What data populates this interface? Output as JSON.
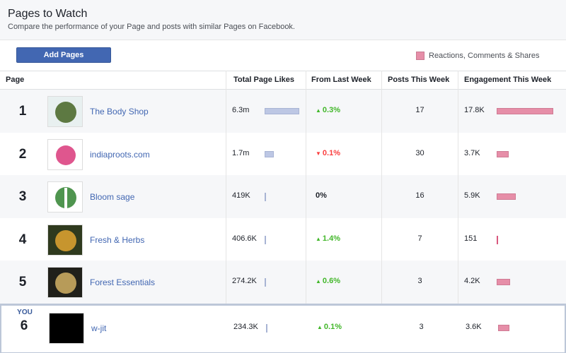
{
  "header": {
    "title": "Pages to Watch",
    "subtitle": "Compare the performance of your Page and posts with similar Pages on Facebook."
  },
  "toolbar": {
    "add_pages_label": "Add Pages"
  },
  "legend": {
    "label": "Reactions, Comments & Shares",
    "color": "#e68ea8"
  },
  "colors": {
    "accent": "#4267b2",
    "positive": "#42b72a",
    "negative": "#fa3e3e",
    "likes_bar": "#bdc7e4",
    "engagement_bar": "#e68ea8"
  },
  "table": {
    "columns": [
      "Page",
      "Total Page Likes",
      "From Last Week",
      "Posts This Week",
      "Engagement This Week"
    ],
    "you_label": "YOU",
    "rows": [
      {
        "rank": "1",
        "name": "The Body Shop",
        "likes": "6.3m",
        "likes_value": 6300000,
        "change": "0.3%",
        "direction": "up",
        "posts": "17",
        "engagement": "17.8K",
        "engagement_value": 17800,
        "is_you": false,
        "thumb_icon": "page-logo-icon"
      },
      {
        "rank": "2",
        "name": "indiaproots.com",
        "likes": "1.7m",
        "likes_value": 1700000,
        "change": "0.1%",
        "direction": "down",
        "posts": "30",
        "engagement": "3.7K",
        "engagement_value": 3700,
        "is_you": false,
        "thumb_icon": "page-logo-icon"
      },
      {
        "rank": "3",
        "name": "Bloom sage",
        "likes": "419K",
        "likes_value": 419000,
        "change": "0%",
        "direction": "flat",
        "posts": "16",
        "engagement": "5.9K",
        "engagement_value": 5900,
        "is_you": false,
        "thumb_icon": "page-logo-icon"
      },
      {
        "rank": "4",
        "name": "Fresh & Herbs",
        "likes": "406.6K",
        "likes_value": 406600,
        "change": "1.4%",
        "direction": "up",
        "posts": "7",
        "engagement": "151",
        "engagement_value": 151,
        "is_you": false,
        "thumb_icon": "page-logo-icon"
      },
      {
        "rank": "5",
        "name": "Forest Essentials",
        "likes": "274.2K",
        "likes_value": 274200,
        "change": "0.6%",
        "direction": "up",
        "posts": "3",
        "engagement": "4.2K",
        "engagement_value": 4200,
        "is_you": false,
        "thumb_icon": "page-logo-icon"
      },
      {
        "rank": "6",
        "name": "w-jit",
        "likes": "234.3K",
        "likes_value": 234300,
        "change": "0.1%",
        "direction": "up",
        "posts": "3",
        "engagement": "3.6K",
        "engagement_value": 3600,
        "is_you": true,
        "thumb_icon": "page-logo-icon"
      }
    ]
  }
}
